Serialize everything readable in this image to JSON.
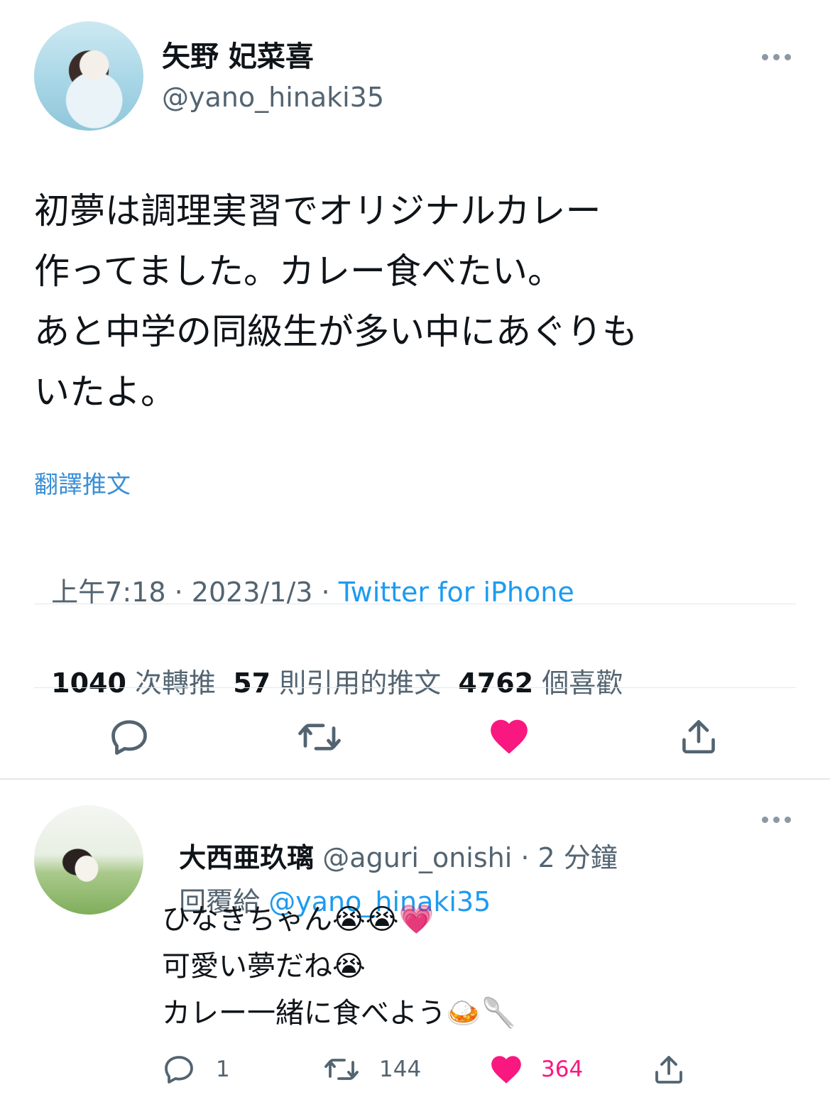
{
  "tweet": {
    "display_name": "矢野 妃菜喜",
    "handle": "@yano_hinaki35",
    "text": "初夢は調理実習でオリジナルカレー\n作ってました。カレー食べたい。\nあと中学の同級生が多い中にあぐりも\nいたよ。",
    "translate_label": "翻譯推文",
    "time": "上午7:18",
    "sep1": " · ",
    "date": "2023/1/3",
    "sep2": " · ",
    "client": "Twitter for iPhone",
    "stats": {
      "retweets_count": "1040",
      "retweets_label": "次轉推",
      "quotes_count": "57",
      "quotes_label": "則引用的推文",
      "likes_count": "4762",
      "likes_label": "個喜歡"
    },
    "icons": [
      "reply-icon",
      "retweet-icon",
      "like-icon",
      "share-icon"
    ]
  },
  "reply": {
    "display_name": "大西亜玖璃",
    "handle": "@aguri_onishi",
    "time": "· 2 分鐘",
    "replying_to_label": "回覆給",
    "replying_to_handle": "@yano_hinaki35",
    "text": "ひなきちゃん😭😭💗\n可愛い夢だね😭\nカレー一緒に食べよう🍛🥄",
    "reply_count": "1",
    "retweet_count": "144",
    "like_count": "364"
  },
  "colors": {
    "accent": "#1d9bf0",
    "like": "#f91880",
    "muted": "#536471",
    "icon": "#536471",
    "divider": "#e3e7ea"
  }
}
